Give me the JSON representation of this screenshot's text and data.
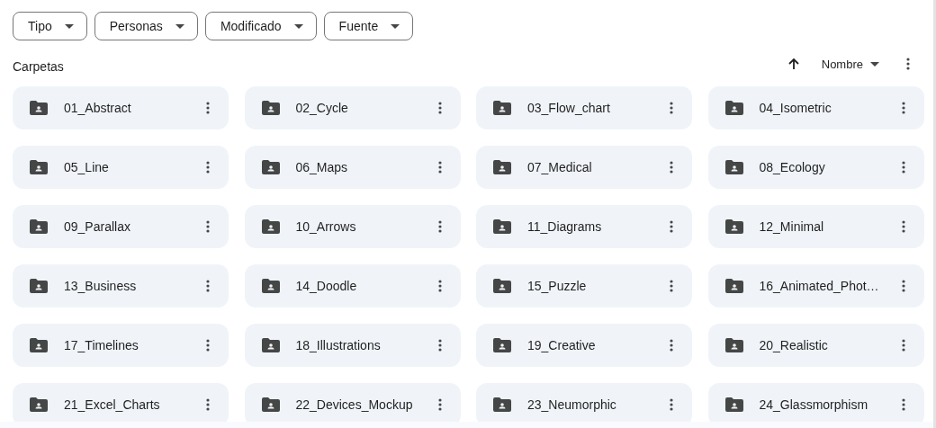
{
  "filters": [
    {
      "label": "Tipo"
    },
    {
      "label": "Personas"
    },
    {
      "label": "Modificado"
    },
    {
      "label": "Fuente"
    }
  ],
  "section_title": "Carpetas",
  "sort": {
    "label": "Nombre"
  },
  "folders": [
    {
      "name": "01_Abstract"
    },
    {
      "name": "02_Cycle"
    },
    {
      "name": "03_Flow_chart"
    },
    {
      "name": "04_Isometric"
    },
    {
      "name": "05_Line"
    },
    {
      "name": "06_Maps"
    },
    {
      "name": "07_Medical"
    },
    {
      "name": "08_Ecology"
    },
    {
      "name": "09_Parallax"
    },
    {
      "name": "10_Arrows"
    },
    {
      "name": "11_Diagrams"
    },
    {
      "name": "12_Minimal"
    },
    {
      "name": "13_Business"
    },
    {
      "name": "14_Doodle"
    },
    {
      "name": "15_Puzzle"
    },
    {
      "name": "16_Animated_Phot…"
    },
    {
      "name": "17_Timelines"
    },
    {
      "name": "18_Illustrations"
    },
    {
      "name": "19_Creative"
    },
    {
      "name": "20_Realistic"
    },
    {
      "name": "21_Excel_Charts"
    },
    {
      "name": "22_Devices_Mockup"
    },
    {
      "name": "23_Neumorphic"
    },
    {
      "name": "24_Glassmorphism"
    }
  ]
}
